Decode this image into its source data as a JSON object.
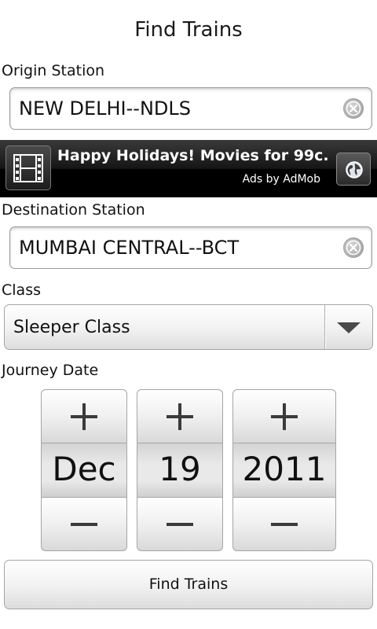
{
  "page": {
    "title": "Find Trains"
  },
  "origin": {
    "label": "Origin Station",
    "value": "NEW DELHI--NDLS"
  },
  "ad": {
    "headline": "Happy Holidays! Movies for 99c.",
    "attribution": "Ads by AdMob",
    "thumb_icon": "film-icon",
    "action_icon": "globe-icon"
  },
  "destination": {
    "label": "Destination Station",
    "value": "MUMBAI CENTRAL--BCT"
  },
  "travel_class": {
    "label": "Class",
    "selected": "Sleeper Class"
  },
  "journey_date": {
    "label": "Journey Date",
    "month": "Dec",
    "day": "19",
    "year": "2011"
  },
  "actions": {
    "find_label": "Find Trains"
  },
  "icons": {
    "clear": "clear-icon",
    "dropdown": "chevron-down-icon",
    "increment": "plus-icon",
    "decrement": "minus-icon"
  }
}
